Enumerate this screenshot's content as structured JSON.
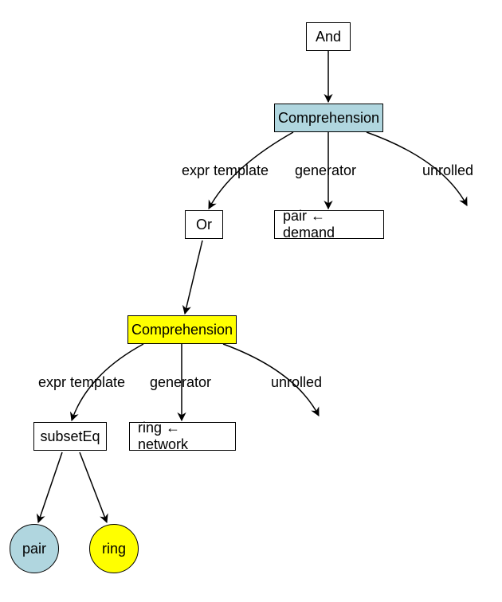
{
  "chart_data": {
    "type": "tree",
    "title": "",
    "nodes": [
      {
        "id": "and",
        "label": "And",
        "shape": "rect",
        "fill": "#ffffff"
      },
      {
        "id": "comp1",
        "label": "Comprehension",
        "shape": "rect",
        "fill": "#b0d6df"
      },
      {
        "id": "or",
        "label": "Or",
        "shape": "rect",
        "fill": "#ffffff"
      },
      {
        "id": "pairdemand",
        "label": "pair ← demand",
        "shape": "rect",
        "fill": "#ffffff"
      },
      {
        "id": "comp2",
        "label": "Comprehension",
        "shape": "rect",
        "fill": "#ffff00"
      },
      {
        "id": "subseteq",
        "label": "subsetEq",
        "shape": "rect",
        "fill": "#ffffff"
      },
      {
        "id": "ringnetwork",
        "label": "ring ← network",
        "shape": "rect",
        "fill": "#ffffff"
      },
      {
        "id": "pair",
        "label": "pair",
        "shape": "circle",
        "fill": "#b0d6df"
      },
      {
        "id": "ring",
        "label": "ring",
        "shape": "circle",
        "fill": "#ffff00"
      }
    ],
    "edges": [
      {
        "from": "and",
        "to": "comp1",
        "label": ""
      },
      {
        "from": "comp1",
        "to": "or",
        "label": "expr template"
      },
      {
        "from": "comp1",
        "to": "pairdemand",
        "label": "generator"
      },
      {
        "from": "comp1",
        "to": "unrolled1",
        "label": "unrolled"
      },
      {
        "from": "or",
        "to": "comp2",
        "label": ""
      },
      {
        "from": "comp2",
        "to": "subseteq",
        "label": "expr template"
      },
      {
        "from": "comp2",
        "to": "ringnetwork",
        "label": "generator"
      },
      {
        "from": "comp2",
        "to": "unrolled2",
        "label": "unrolled"
      },
      {
        "from": "subseteq",
        "to": "pair",
        "label": ""
      },
      {
        "from": "subseteq",
        "to": "ring",
        "label": ""
      }
    ]
  },
  "labels": {
    "and": "And",
    "comp1": "Comprehension",
    "or": "Or",
    "pairdemand": "pair ← demand",
    "comp2": "Comprehension",
    "subseteq": "subsetEq",
    "ringnetwork": "ring ← network",
    "pair": "pair",
    "ring": "ring",
    "expr_template": "expr template",
    "generator": "generator",
    "unrolled": "unrolled"
  },
  "colors": {
    "blue": "#b0d6df",
    "yellow": "#ffff00",
    "white": "#ffffff"
  }
}
